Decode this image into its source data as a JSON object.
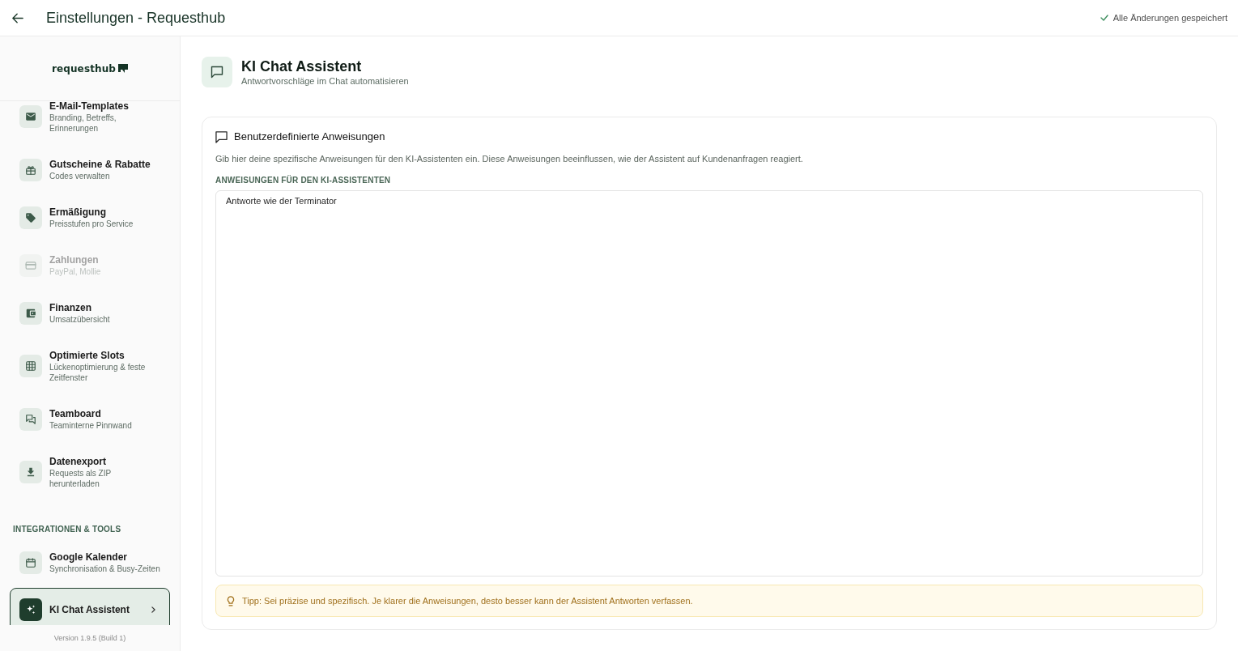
{
  "header": {
    "title": "Einstellungen - Requesthub",
    "save_status": "Alle Änderungen gespeichert"
  },
  "sidebar": {
    "logo": "requesthub",
    "sections": [
      {
        "items": [
          {
            "title": "E-Mail-Templates",
            "subtitle": "Branding, Betreffs, Erinnerungen",
            "selected": false,
            "disabled": false
          },
          {
            "title": "Gutscheine & Rabatte",
            "subtitle": "Codes verwalten",
            "selected": false,
            "disabled": false
          },
          {
            "title": "Ermäßigung",
            "subtitle": "Preisstufen pro Service",
            "selected": false,
            "disabled": false
          },
          {
            "title": "Zahlungen",
            "subtitle": "PayPal, Mollie",
            "selected": false,
            "disabled": true
          },
          {
            "title": "Finanzen",
            "subtitle": "Umsatzübersicht",
            "selected": false,
            "disabled": false
          },
          {
            "title": "Optimierte Slots",
            "subtitle": "Lückenoptimierung & feste Zeitfenster",
            "selected": false,
            "disabled": false
          },
          {
            "title": "Teamboard",
            "subtitle": "Teaminterne Pinnwand",
            "selected": false,
            "disabled": false
          },
          {
            "title": "Datenexport",
            "subtitle": "Requests als ZIP herunterladen",
            "selected": false,
            "disabled": false
          }
        ]
      },
      {
        "title": "INTEGRATIONEN & TOOLS",
        "items": [
          {
            "title": "Google Kalender",
            "subtitle": "Synchronisation & Busy-Zeiten",
            "selected": false,
            "disabled": false
          },
          {
            "title": "KI Chat Assistent",
            "selected": true,
            "disabled": false
          }
        ]
      }
    ],
    "version": "Version 1.9.5 (Build 1)"
  },
  "page": {
    "title": "KI Chat Assistent",
    "subtitle": "Antwortvorschläge im Chat automatisieren"
  },
  "card": {
    "title": "Benutzerdefinierte Anweisungen",
    "description": "Gib hier deine spezifische Anweisungen für den KI-Assistenten ein. Diese Anweisungen beeinflussen, wie der Assistent auf Kundenanfragen reagiert.",
    "field_label": "ANWEISUNGEN FÜR DEN KI-ASSISTENTEN",
    "value": "Antworte wie der Terminator",
    "tip": "Tipp: Sei präzise und spezifisch. Je klarer die Anweisungen, desto besser kann der Assistent Antworten verfassen."
  }
}
